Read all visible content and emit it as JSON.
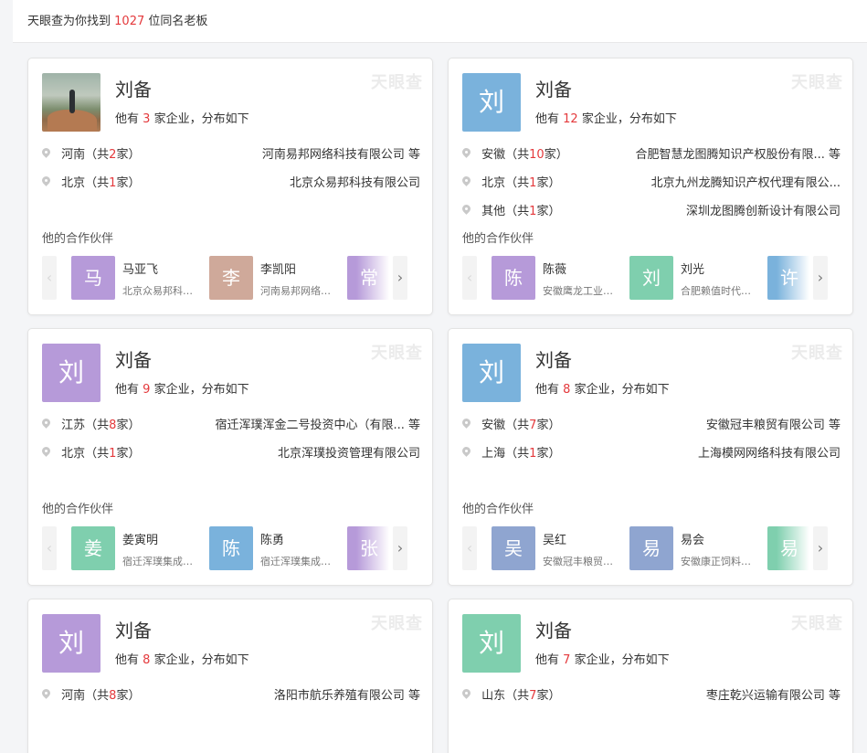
{
  "header": {
    "prefix": "天眼查为你找到",
    "count": "1027",
    "suffix": "位同名老板"
  },
  "colors": {
    "accent_red": "#e4393c",
    "purple": "#b69ad9",
    "blue": "#7ab2dc",
    "green": "#7fcfae",
    "tan": "#cfa99a",
    "slate": "#8fa5d0"
  },
  "watermark": "天眼查",
  "partner_title": "他的合作伙伴",
  "cards": [
    {
      "avatar_char": "",
      "avatar_color": "photo",
      "name": "刘备",
      "summary_pre": "他有",
      "count": "3",
      "summary_post": "家企业，分布如下",
      "locations": [
        {
          "province": "河南（共",
          "n": "2",
          "tail": "家）",
          "company": "河南易邦网络科技有限公司 等"
        },
        {
          "province": "北京（共",
          "n": "1",
          "tail": "家）",
          "company": "北京众易邦科技有限公司"
        }
      ],
      "partners": [
        {
          "char": "马",
          "color": "#b69ad9",
          "name": "马亚飞",
          "company": "北京众易邦科技有限公司"
        },
        {
          "char": "李",
          "color": "#cfa99a",
          "name": "李凯阳",
          "company": "河南易邦网络科技有限公司"
        },
        {
          "char": "常",
          "color": "#b69ad9",
          "name": "",
          "company": ""
        }
      ]
    },
    {
      "avatar_char": "刘",
      "avatar_color": "#7ab2dc",
      "name": "刘备",
      "summary_pre": "他有",
      "count": "12",
      "summary_post": "家企业，分布如下",
      "locations": [
        {
          "province": "安徽（共",
          "n": "10",
          "tail": "家）",
          "company": "合肥智慧龙图腾知识产权股份有限... 等"
        },
        {
          "province": "北京（共",
          "n": "1",
          "tail": "家）",
          "company": "北京九州龙腾知识产权代理有限公..."
        },
        {
          "province": "其他（共",
          "n": "1",
          "tail": "家）",
          "company": "深圳龙图腾创新设计有限公司"
        }
      ],
      "partners": [
        {
          "char": "陈",
          "color": "#b69ad9",
          "name": "陈薇",
          "company": "安徽鹰龙工业设计有限公司"
        },
        {
          "char": "刘",
          "color": "#7fcfae",
          "name": "刘光",
          "company": "合肥赖值时代科技有限公司"
        },
        {
          "char": "许",
          "color": "#7ab2dc",
          "name": "",
          "company": ""
        }
      ]
    },
    {
      "avatar_char": "刘",
      "avatar_color": "#b69ad9",
      "name": "刘备",
      "summary_pre": "他有",
      "count": "9",
      "summary_post": "家企业，分布如下",
      "locations": [
        {
          "province": "江苏（共",
          "n": "8",
          "tail": "家）",
          "company": "宿迁浑璞浑金二号投资中心（有限... 等"
        },
        {
          "province": "北京（共",
          "n": "1",
          "tail": "家）",
          "company": "北京浑璞投资管理有限公司"
        }
      ],
      "partners": [
        {
          "char": "姜",
          "color": "#7fcfae",
          "name": "姜寅明",
          "company": "宿迁浑璞集成投资中心"
        },
        {
          "char": "陈",
          "color": "#7ab2dc",
          "name": "陈勇",
          "company": "宿迁浑璞集成投资中心"
        },
        {
          "char": "张",
          "color": "#b69ad9",
          "name": "",
          "company": ""
        }
      ]
    },
    {
      "avatar_char": "刘",
      "avatar_color": "#7ab2dc",
      "name": "刘备",
      "summary_pre": "他有",
      "count": "8",
      "summary_post": "家企业，分布如下",
      "locations": [
        {
          "province": "安徽（共",
          "n": "7",
          "tail": "家）",
          "company": "安徽冠丰粮贸有限公司 等"
        },
        {
          "province": "上海（共",
          "n": "1",
          "tail": "家）",
          "company": "上海模网网络科技有限公司"
        }
      ],
      "partners": [
        {
          "char": "吴",
          "color": "#8fa5d0",
          "name": "吴红",
          "company": "安徽冠丰粮贸有限公司"
        },
        {
          "char": "易",
          "color": "#8fa5d0",
          "name": "易会",
          "company": "安徽康正饲料有限公司"
        },
        {
          "char": "易",
          "color": "#7fcfae",
          "name": "",
          "company": ""
        }
      ]
    },
    {
      "avatar_char": "刘",
      "avatar_color": "#b69ad9",
      "name": "刘备",
      "summary_pre": "他有",
      "count": "8",
      "summary_post": "家企业，分布如下",
      "locations": [
        {
          "province": "河南（共",
          "n": "8",
          "tail": "家）",
          "company": "洛阳市航乐养殖有限公司 等"
        }
      ],
      "partners": []
    },
    {
      "avatar_char": "刘",
      "avatar_color": "#7fcfae",
      "name": "刘备",
      "summary_pre": "他有",
      "count": "7",
      "summary_post": "家企业，分布如下",
      "locations": [
        {
          "province": "山东（共",
          "n": "7",
          "tail": "家）",
          "company": "枣庄乾兴运输有限公司 等"
        }
      ],
      "partners": []
    }
  ]
}
